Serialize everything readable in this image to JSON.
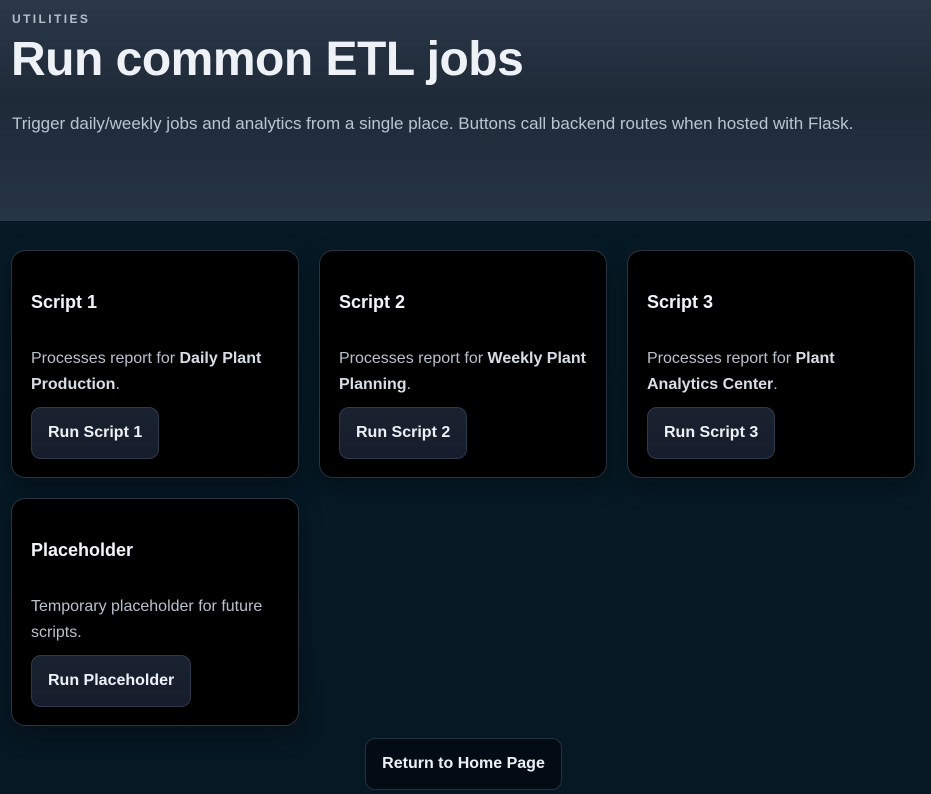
{
  "header": {
    "eyebrow": "UTILITIES",
    "title": "Run common ETL jobs",
    "subtitle": "Trigger daily/weekly jobs and analytics from a single place. Buttons call backend routes when hosted with Flask."
  },
  "cards": [
    {
      "title": "Script 1",
      "desc_prefix": "Processes report for ",
      "desc_bold": "Daily Plant Production",
      "desc_suffix": ".",
      "button_label": "Run Script 1"
    },
    {
      "title": "Script 2",
      "desc_prefix": "Processes report for ",
      "desc_bold": "Weekly Plant Planning",
      "desc_suffix": ".",
      "button_label": "Run Script 2"
    },
    {
      "title": "Script 3",
      "desc_prefix": "Processes report for ",
      "desc_bold": "Plant Analytics Center",
      "desc_suffix": ".",
      "button_label": "Run Script 3"
    },
    {
      "title": "Placeholder",
      "desc_prefix": "Temporary placeholder for future scripts.",
      "desc_bold": "",
      "desc_suffix": "",
      "button_label": "Run Placeholder"
    }
  ],
  "footer": {
    "home_label": "Return to Home Page"
  }
}
